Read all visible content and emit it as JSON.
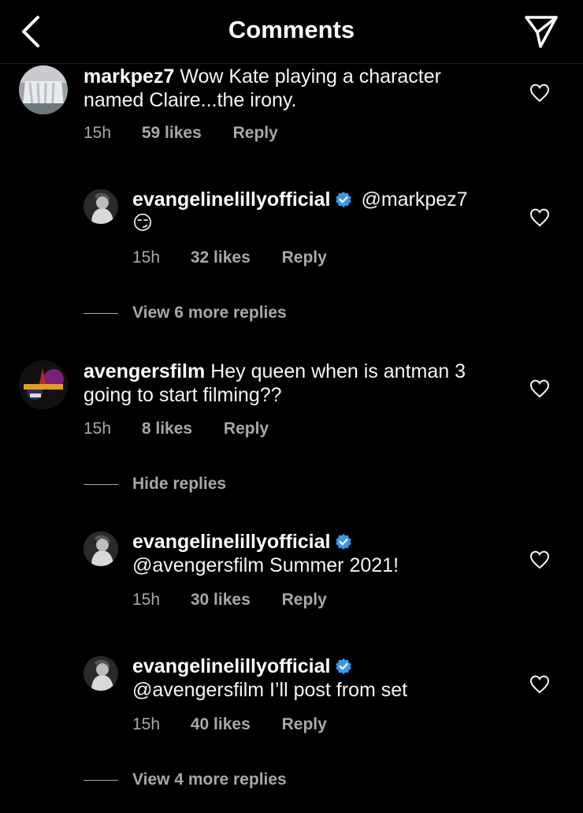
{
  "header": {
    "title": "Comments",
    "back_icon": "chevron-left-icon",
    "send_icon": "paper-plane-icon"
  },
  "comments": [
    {
      "username": "markpez7",
      "text_line1": "Wow Kate playing a character",
      "text_line2": "named Claire...the irony.",
      "time": "15h",
      "likes": "59 likes",
      "reply": "Reply"
    },
    {
      "username": "evangelinelillyofficial",
      "mention": "@markpez7",
      "emoji": "😏",
      "time": "15h",
      "likes": "32 likes",
      "reply": "Reply"
    },
    {
      "username": "avengersfilm",
      "text_line1": "Hey queen when is antman 3",
      "text_line2": "going to start filming??",
      "time": "15h",
      "likes": "8 likes",
      "reply": "Reply"
    },
    {
      "username": "evangelinelillyofficial",
      "text_line2": "@avengersfilm Summer 2021!",
      "time": "15h",
      "likes": "30 likes",
      "reply": "Reply"
    },
    {
      "username": "evangelinelillyofficial",
      "text_line2": "@avengersfilm I’ll post from set",
      "time": "15h",
      "likes": "40 likes",
      "reply": "Reply"
    }
  ],
  "threads": {
    "view_more_1": "View 6 more replies",
    "hide_replies": "Hide replies",
    "view_more_2": "View 4 more replies"
  },
  "colors": {
    "background": "#000000",
    "text": "#f5f5f5",
    "secondary": "#a8a8a8",
    "verified": "#3897f0"
  }
}
